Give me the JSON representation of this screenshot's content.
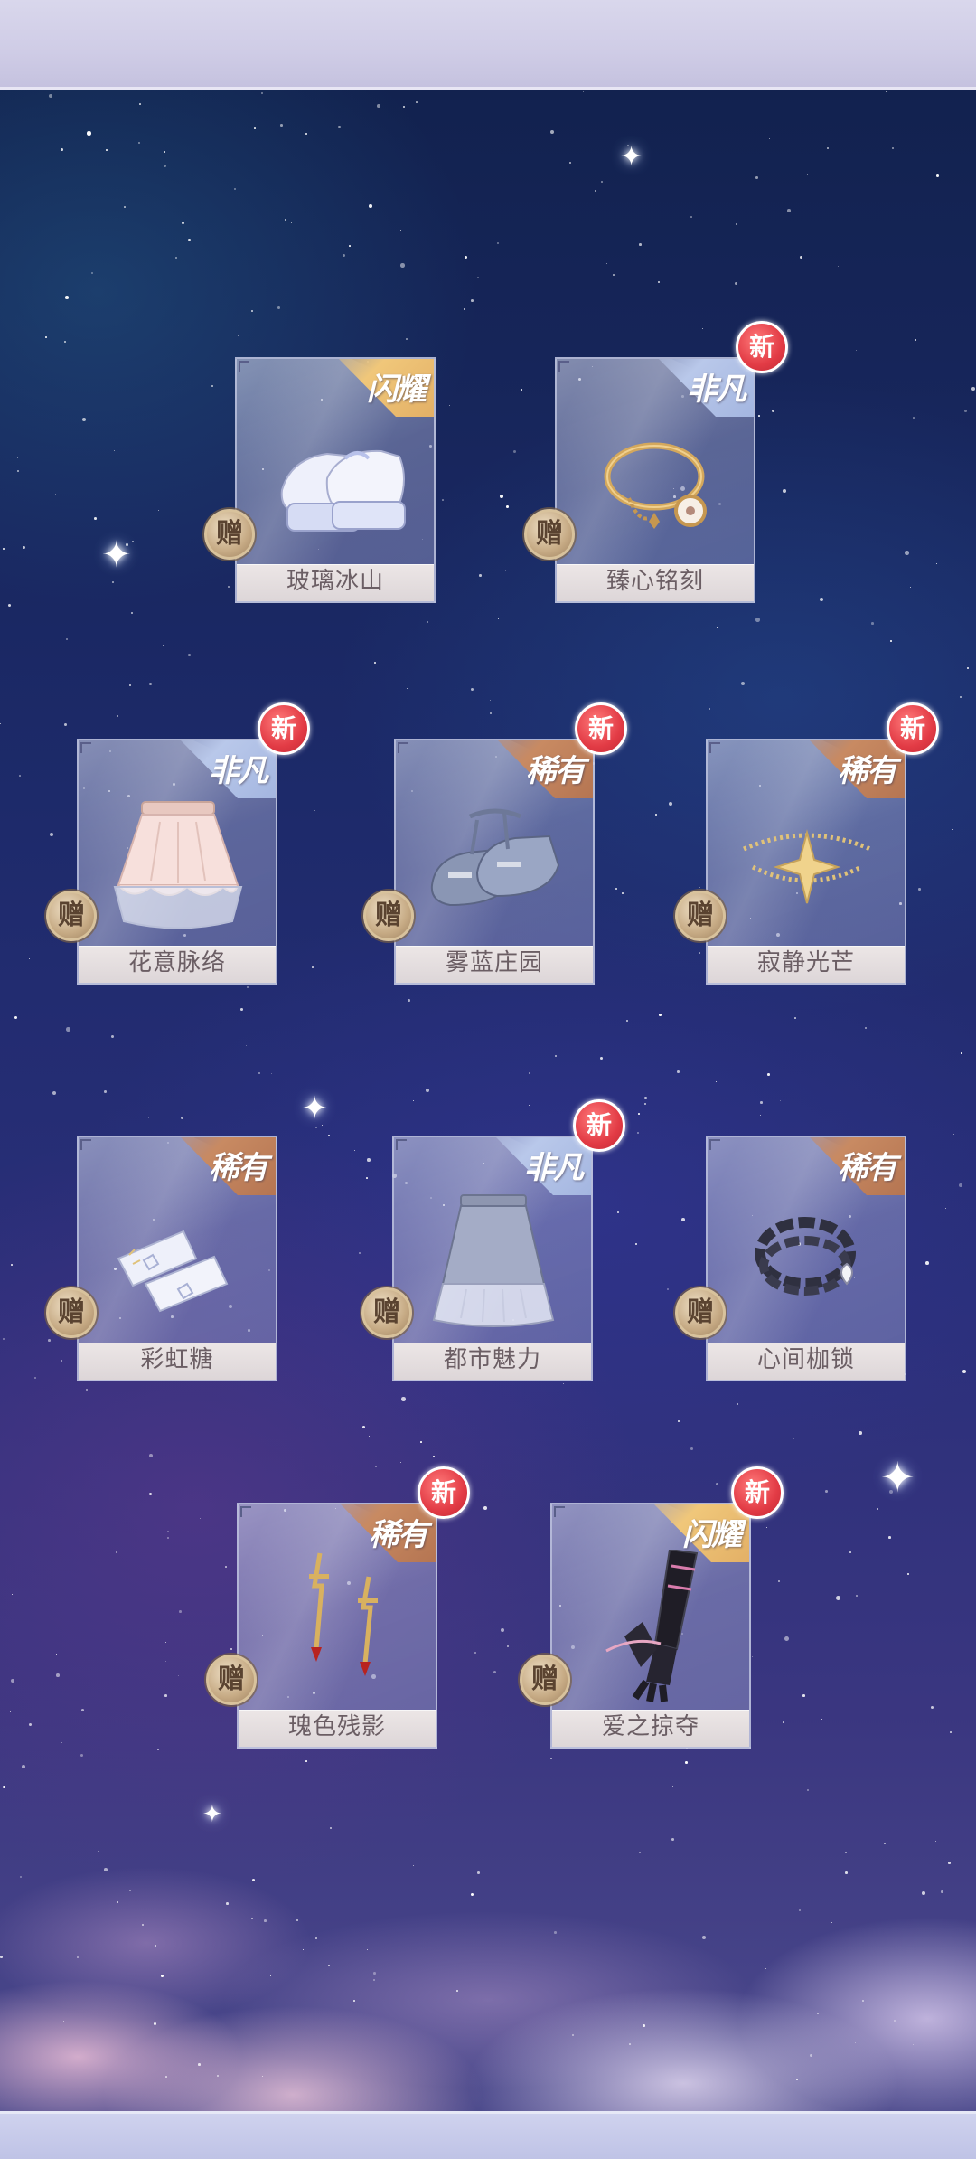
{
  "items": [
    {
      "name": "玻璃冰山",
      "rarity": "闪耀",
      "gift": "赠",
      "new": ""
    },
    {
      "name": "臻心铭刻",
      "rarity": "非凡",
      "gift": "赠",
      "new": "新"
    },
    {
      "name": "花意脉络",
      "rarity": "非凡",
      "gift": "赠",
      "new": "新"
    },
    {
      "name": "雾蓝庄园",
      "rarity": "稀有",
      "gift": "赠",
      "new": "新"
    },
    {
      "name": "寂静光芒",
      "rarity": "稀有",
      "gift": "赠",
      "new": "新"
    },
    {
      "name": "彩虹糖",
      "rarity": "稀有",
      "gift": "赠",
      "new": ""
    },
    {
      "name": "都市魅力",
      "rarity": "非凡",
      "gift": "赠",
      "new": "新"
    },
    {
      "name": "心间枷锁",
      "rarity": "稀有",
      "gift": "赠",
      "new": ""
    },
    {
      "name": "瑰色残影",
      "rarity": "稀有",
      "gift": "赠",
      "new": "新"
    },
    {
      "name": "爱之掠夺",
      "rarity": "闪耀",
      "gift": "赠",
      "new": "新"
    }
  ],
  "colors": {
    "rarity_flash": "#e3b066",
    "rarity_rare": "#b57552",
    "rarity_fine": "#a4b6e0",
    "new_badge": "#e23b45",
    "gift_badge": "#c6aa84"
  }
}
